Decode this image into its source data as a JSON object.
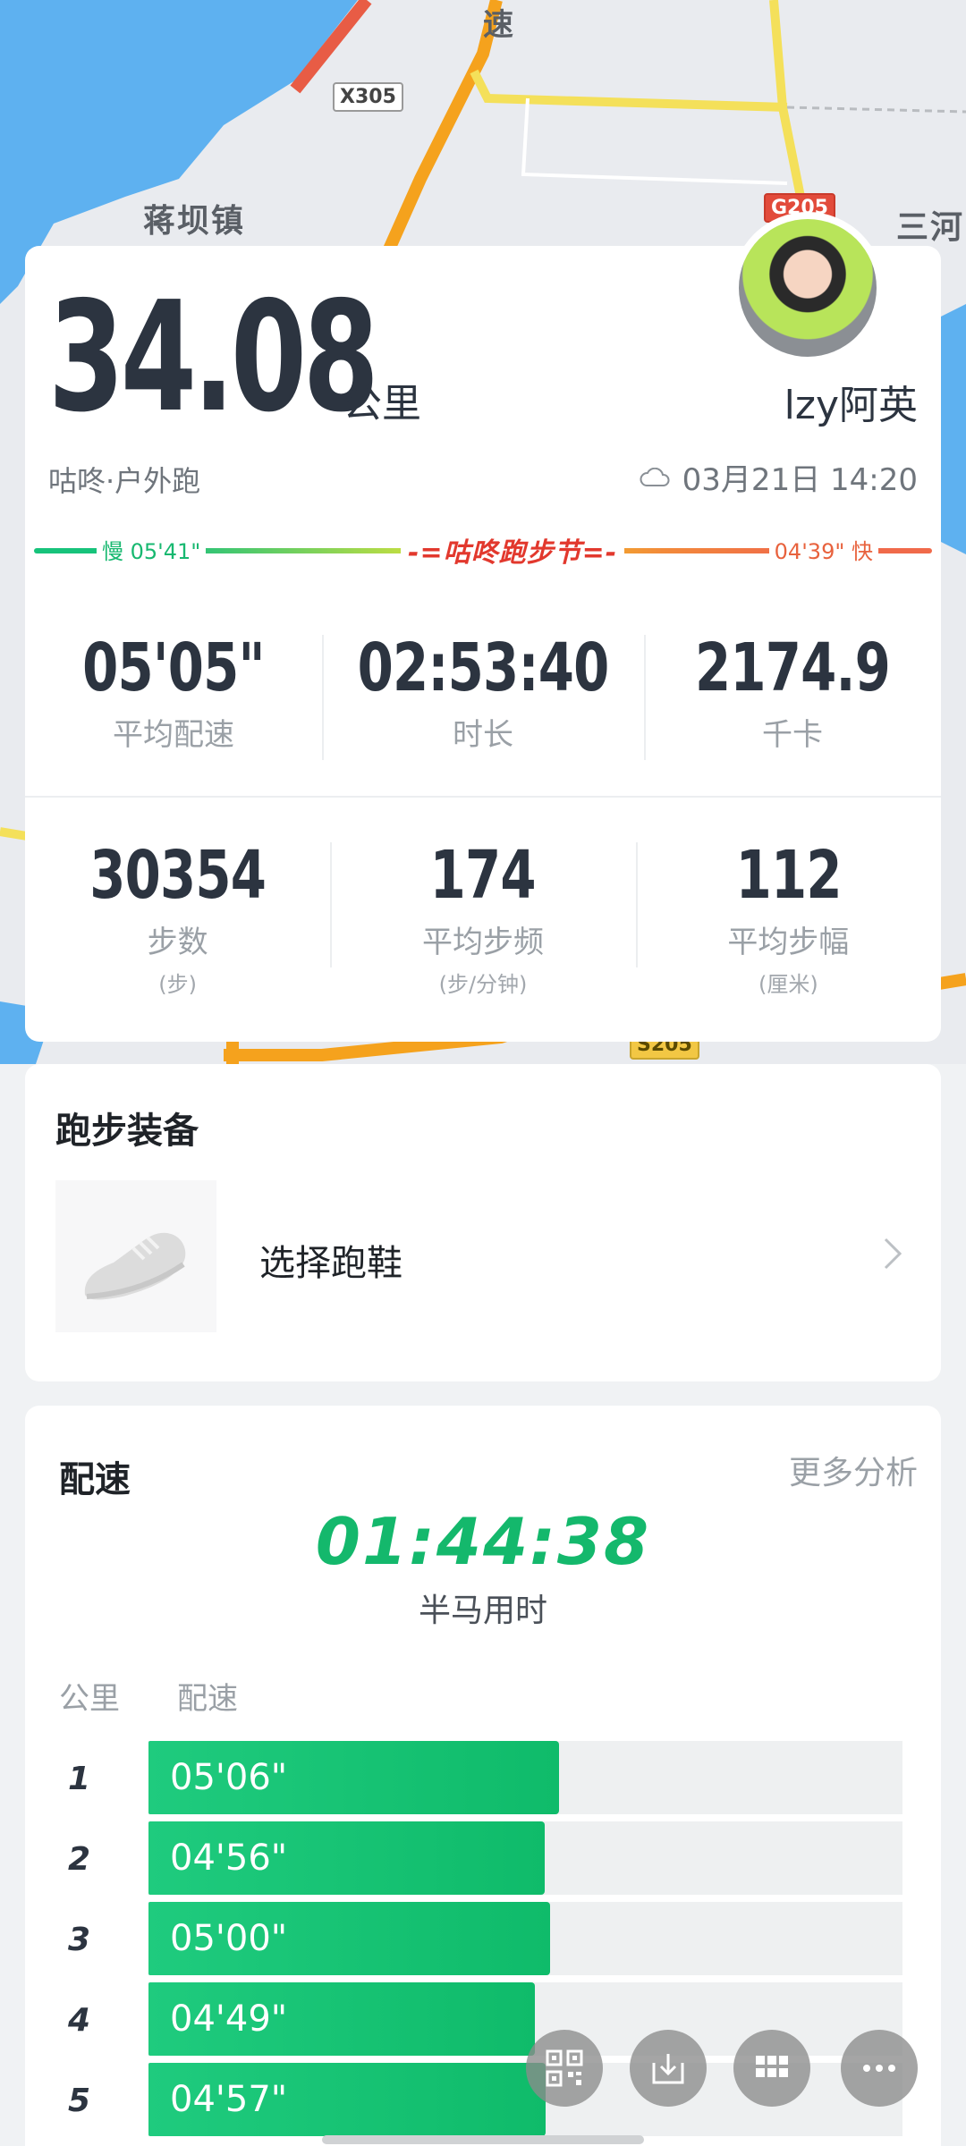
{
  "map": {
    "place_labels": [
      "速",
      "蒋坝镇",
      "三河"
    ],
    "road_badges": [
      "X305",
      "G205",
      "S205"
    ]
  },
  "summary": {
    "distance": "34.08",
    "unit": "公里",
    "username": "lzy阿英",
    "activity_type": "咕咚·户外跑",
    "datetime": "03月21日 14:20",
    "pace_slow": "慢 05'41\"",
    "pace_fast": "04'39\" 快",
    "festival_label": "-=咕咚跑步节=-",
    "stats_row1": [
      {
        "value": "05'05\"",
        "label": "平均配速"
      },
      {
        "value": "02:53:40",
        "label": "时长"
      },
      {
        "value": "2174.9",
        "label": "千卡"
      }
    ],
    "stats_row2": [
      {
        "value": "30354",
        "label": "步数",
        "sub": "(步)"
      },
      {
        "value": "174",
        "label": "平均步频",
        "sub": "(步/分钟)"
      },
      {
        "value": "112",
        "label": "平均步幅",
        "sub": "(厘米)"
      }
    ]
  },
  "equipment": {
    "title": "跑步装备",
    "shoe_label": "选择跑鞋"
  },
  "pace": {
    "title": "配速",
    "more": "更多分析",
    "half_marathon_time": "01:44:38",
    "half_marathon_label": "半马用时",
    "col_km": "公里",
    "col_pace": "配速",
    "splits": [
      {
        "km": "1",
        "pace": "05'06\"",
        "fill": 0.545
      },
      {
        "km": "2",
        "pace": "04'56\"",
        "fill": 0.526
      },
      {
        "km": "3",
        "pace": "05'00\"",
        "fill": 0.533
      },
      {
        "km": "4",
        "pace": "04'49\"",
        "fill": 0.512
      },
      {
        "km": "5",
        "pace": "04'57\"",
        "fill": 0.527
      }
    ]
  },
  "fabs": [
    "qrcode-icon",
    "download-icon",
    "grid-icon",
    "more-icon"
  ],
  "colors": {
    "accent_green": "#14b86c",
    "pace_fast": "#e8623d",
    "text_dark": "#2c3440"
  }
}
